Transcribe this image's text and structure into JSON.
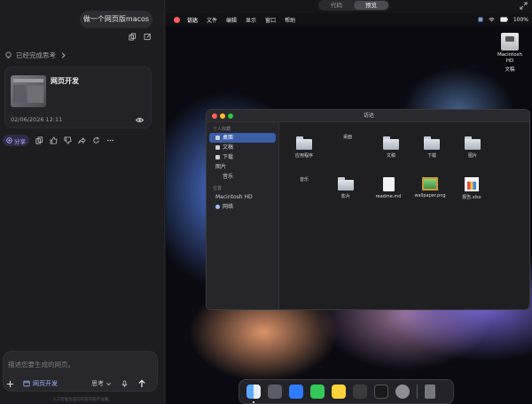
{
  "chat": {
    "user_message": "做一个网页版macos",
    "thinking_status": "已经完成思考",
    "artifact": {
      "title": "网页开发",
      "date": "02/06/2026 12:11"
    },
    "share_label": "分享",
    "composer_placeholder": "描述您要生成的网页。",
    "web_dev_chip": "网页开发",
    "mode_label": "思考",
    "disclaimer": "人工智能生成的内容可能不准确。"
  },
  "preview": {
    "tabs": [
      {
        "label": "代码",
        "active": false
      },
      {
        "label": "预览",
        "active": true
      }
    ],
    "menubar": {
      "items": [
        "访达",
        "文件",
        "编辑",
        "显示",
        "窗口",
        "帮助"
      ],
      "battery": "100%"
    },
    "desktop_icon": {
      "line1": "Macintosh",
      "line2": "HD",
      "line3": "文稿"
    },
    "finder": {
      "title": "访达",
      "sidebar_sections": [
        {
          "heading": "个人收藏",
          "items": [
            "桌面",
            "文稿",
            "下载",
            "图片",
            "音乐"
          ]
        },
        {
          "heading": "位置",
          "items": [
            "Macintosh HD",
            "网络"
          ]
        }
      ],
      "items": [
        {
          "name": "应用程序",
          "kind": "folder"
        },
        {
          "name": "桌面",
          "kind": "folder"
        },
        {
          "name": "文稿",
          "kind": "folder"
        },
        {
          "name": "下载",
          "kind": "folder"
        },
        {
          "name": "图片",
          "kind": "folder"
        },
        {
          "name": "音乐",
          "kind": "folder"
        },
        {
          "name": "影片",
          "kind": "folder"
        },
        {
          "name": "readme.md",
          "kind": "doc"
        },
        {
          "name": "wallpaper.png",
          "kind": "image"
        },
        {
          "name": "报告.xlsx",
          "kind": "spreadsheet"
        }
      ]
    },
    "dock_icons": [
      "finder-icon",
      "launchpad-icon",
      "safari-icon",
      "messages-icon",
      "notes-icon",
      "calculator-icon",
      "terminal-icon",
      "settings-icon",
      "trash-icon"
    ]
  },
  "colors": {
    "accent": "#3a5ea8",
    "share_bg": "#2e2c49",
    "close": "#ff5f57",
    "minimize": "#febc2e",
    "zoom": "#28c840"
  }
}
